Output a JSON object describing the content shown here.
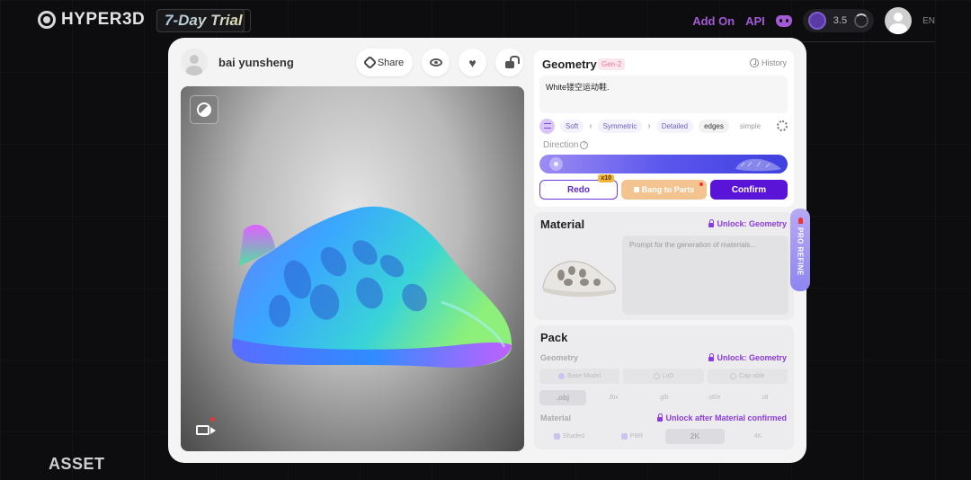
{
  "header": {
    "logo_text": "HYPER3D",
    "trial_badge": "7-Day Trial",
    "add_on": "Add On",
    "api": "API",
    "credits": "3.5",
    "language": "EN"
  },
  "footer": {
    "section_label": "ASSET"
  },
  "asset": {
    "user_name": "bai yunsheng",
    "share_label": "Share"
  },
  "geometry": {
    "title": "Geometry",
    "gen_badge": "Gen-2",
    "history_label": "History",
    "prompt": "White镂空运动鞋.",
    "tags": [
      "Soft",
      "Symmetric",
      "Detailed",
      "edges",
      "simple"
    ],
    "direction_label": "Direction",
    "redo_label": "Redo",
    "redo_badge": "x10",
    "bang_label": "Bang to Parts",
    "confirm_label": "Confirm"
  },
  "material": {
    "title": "Material",
    "unlock_label": "Unlock: Geometry",
    "prompt_placeholder": "Prompt for the generation of materials..."
  },
  "pro_refine": {
    "label": "PRO REFINE"
  },
  "pack": {
    "title": "Pack",
    "geometry_label": "Geometry",
    "geometry_unlock": "Unlock: Geometry",
    "mesh_options": [
      "Base Model",
      "LoD",
      "Cap-able"
    ],
    "formats": [
      ".obj",
      ".fbx",
      ".glb",
      ".stl/e",
      ".stl"
    ],
    "material_label": "Material",
    "material_unlock": "Unlock after Material confirmed",
    "material_options": [
      "Shaded",
      "PBR",
      "2K",
      "4K"
    ]
  },
  "colors": {
    "accent": "#5a14d8",
    "purple_text": "#8a3ae0",
    "bang_orange": "#f3c48f"
  }
}
